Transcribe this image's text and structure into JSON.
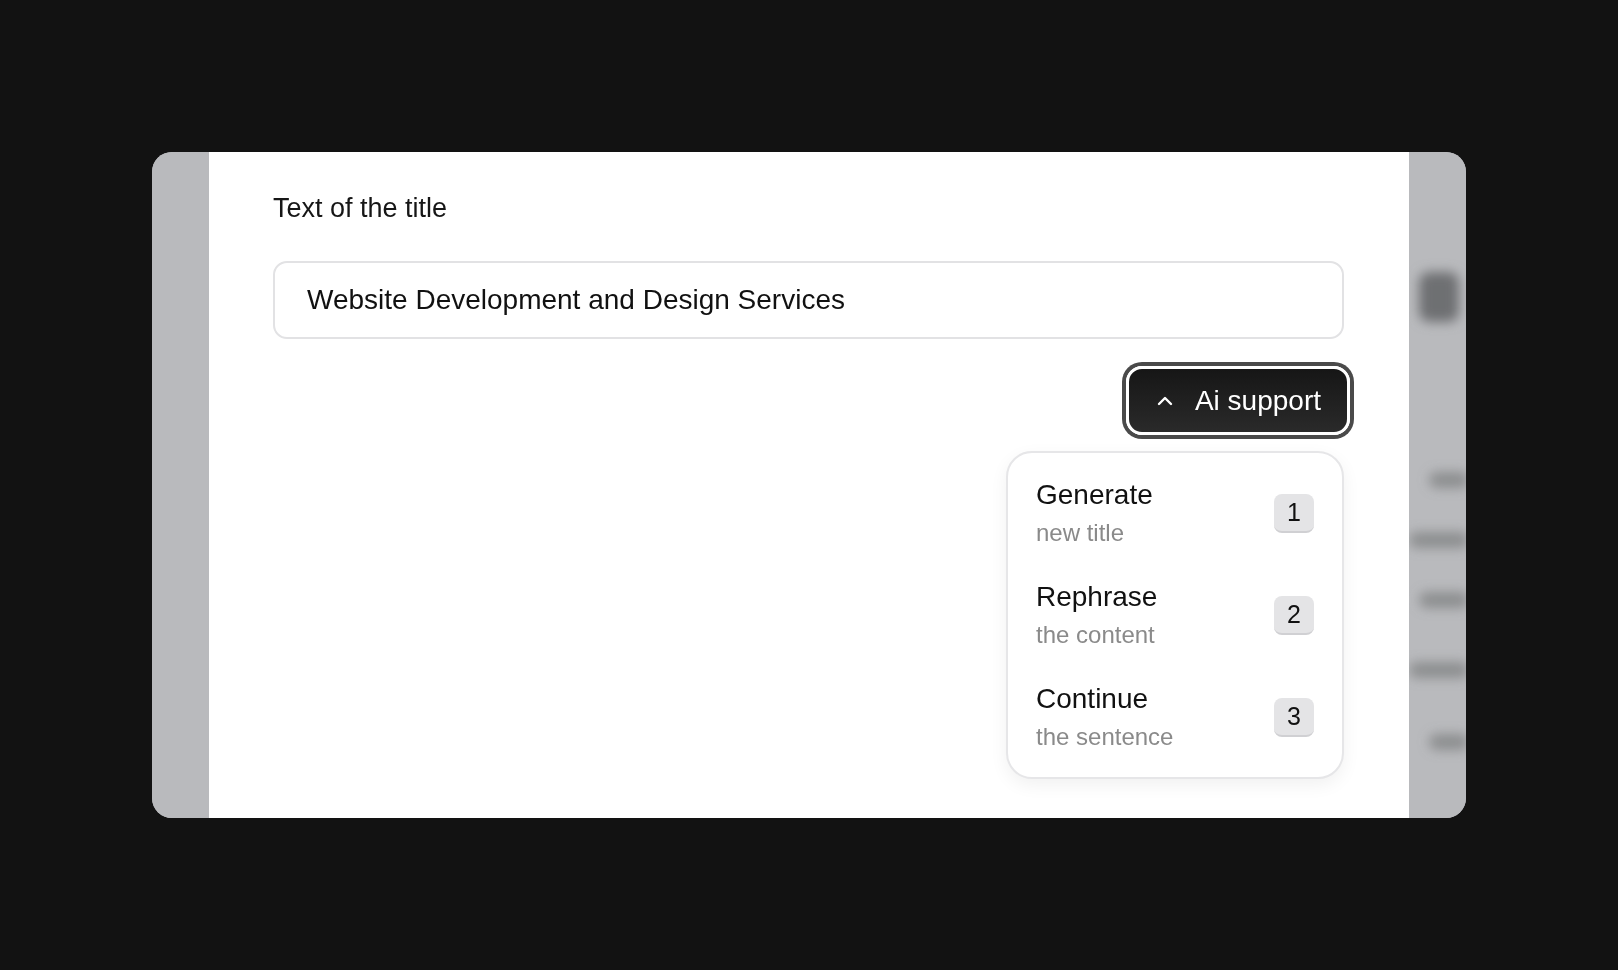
{
  "field": {
    "label": "Text of the title",
    "value": "Website Development and Design Services"
  },
  "ai_button": {
    "label": "Ai support",
    "expanded": true
  },
  "menu": [
    {
      "title": "Generate",
      "subtitle": "new title",
      "shortcut": "1"
    },
    {
      "title": "Rephrase",
      "subtitle": "the content",
      "shortcut": "2"
    },
    {
      "title": "Continue",
      "subtitle": "the sentence",
      "shortcut": "3"
    }
  ]
}
